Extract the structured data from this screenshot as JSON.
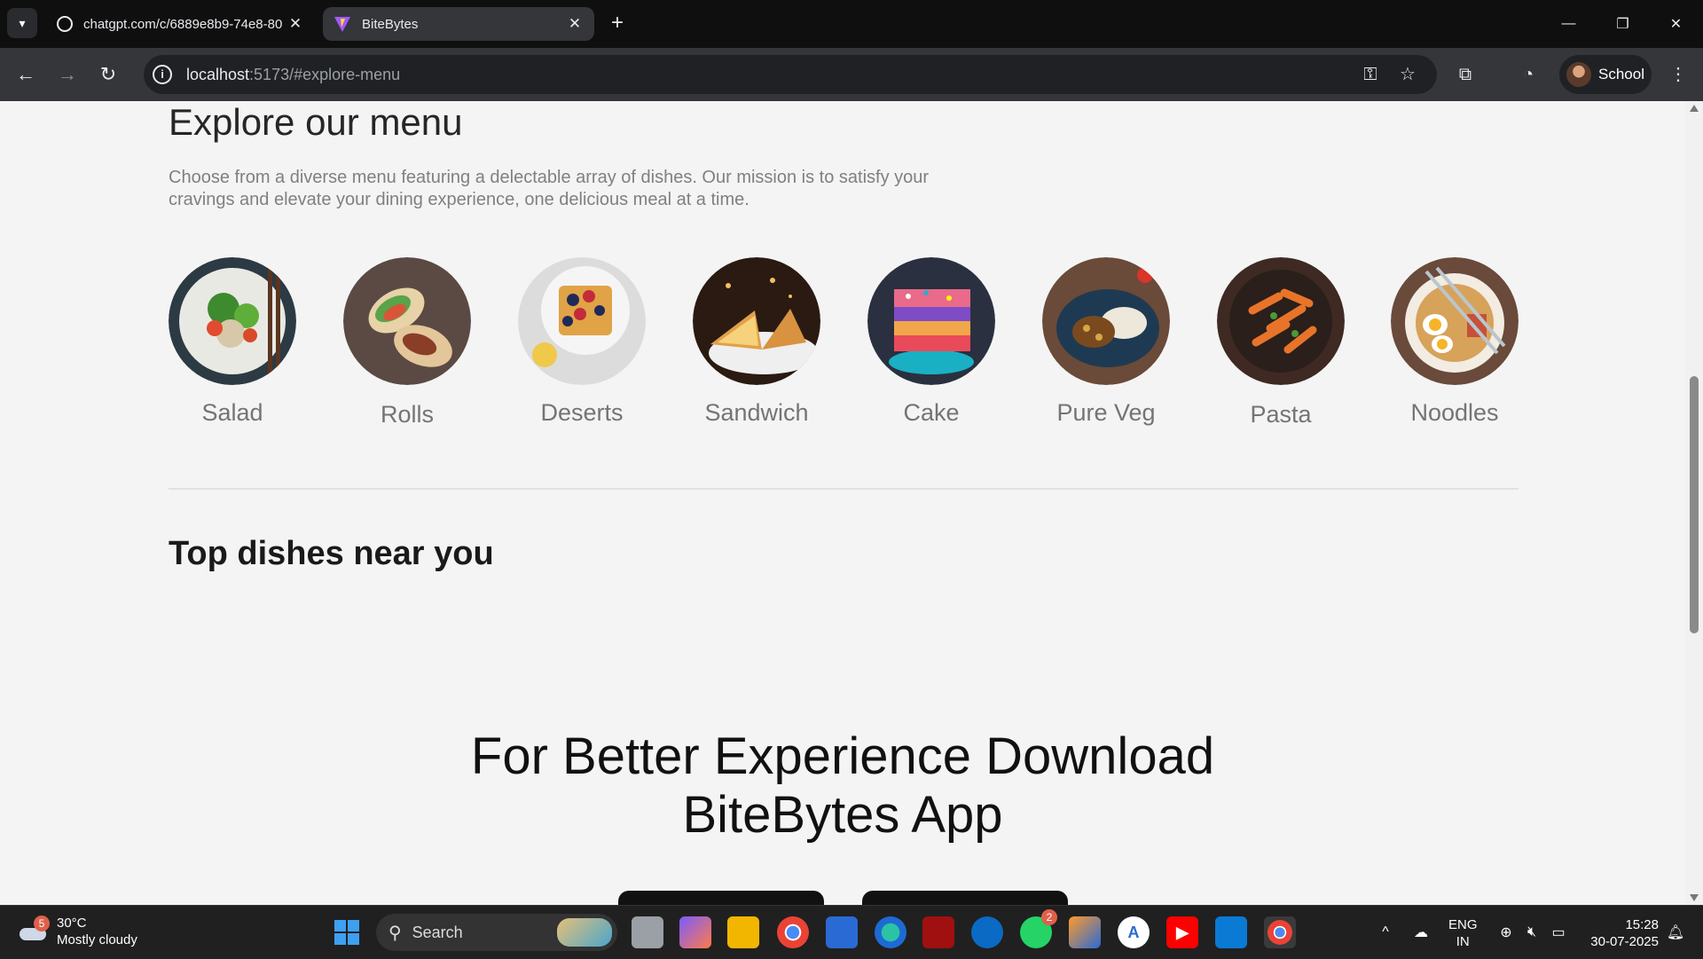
{
  "browser": {
    "tabs": [
      {
        "title": "chatgpt.com/c/6889e8b9-74e8-80",
        "icon": "openai-icon",
        "active": false
      },
      {
        "title": "BiteBytes",
        "icon": "vite-icon",
        "active": true
      }
    ],
    "url_host": "localhost",
    "url_rest": ":5173/#explore-menu",
    "profile_name": "School"
  },
  "page": {
    "explore_title": "Explore our menu",
    "explore_description": "Choose from a diverse menu featuring a delectable array of dishes. Our mission is to satisfy your cravings and elevate your dining experience, one delicious meal at a time.",
    "menu_items": [
      {
        "label": "Salad"
      },
      {
        "label": "Rolls"
      },
      {
        "label": "Deserts"
      },
      {
        "label": "Sandwich"
      },
      {
        "label": "Cake"
      },
      {
        "label": "Pure Veg"
      },
      {
        "label": "Pasta"
      },
      {
        "label": "Noodles"
      }
    ],
    "top_dishes_title": "Top dishes near you",
    "app_download_line1": "For Better Experience Download",
    "app_download_line2": "BiteBytes App"
  },
  "taskbar": {
    "weather_temp": "30°C",
    "weather_desc": "Mostly cloudy",
    "weather_badge": "5",
    "search_label": "Search",
    "whatsapp_badge": "2",
    "lang_line1": "ENG",
    "lang_line2": "IN",
    "time": "15:28",
    "date": "30-07-2025"
  },
  "colors": {
    "page_bg": "#f4f4f4",
    "title": "#262626",
    "desc": "#808080",
    "label": "#747474"
  }
}
